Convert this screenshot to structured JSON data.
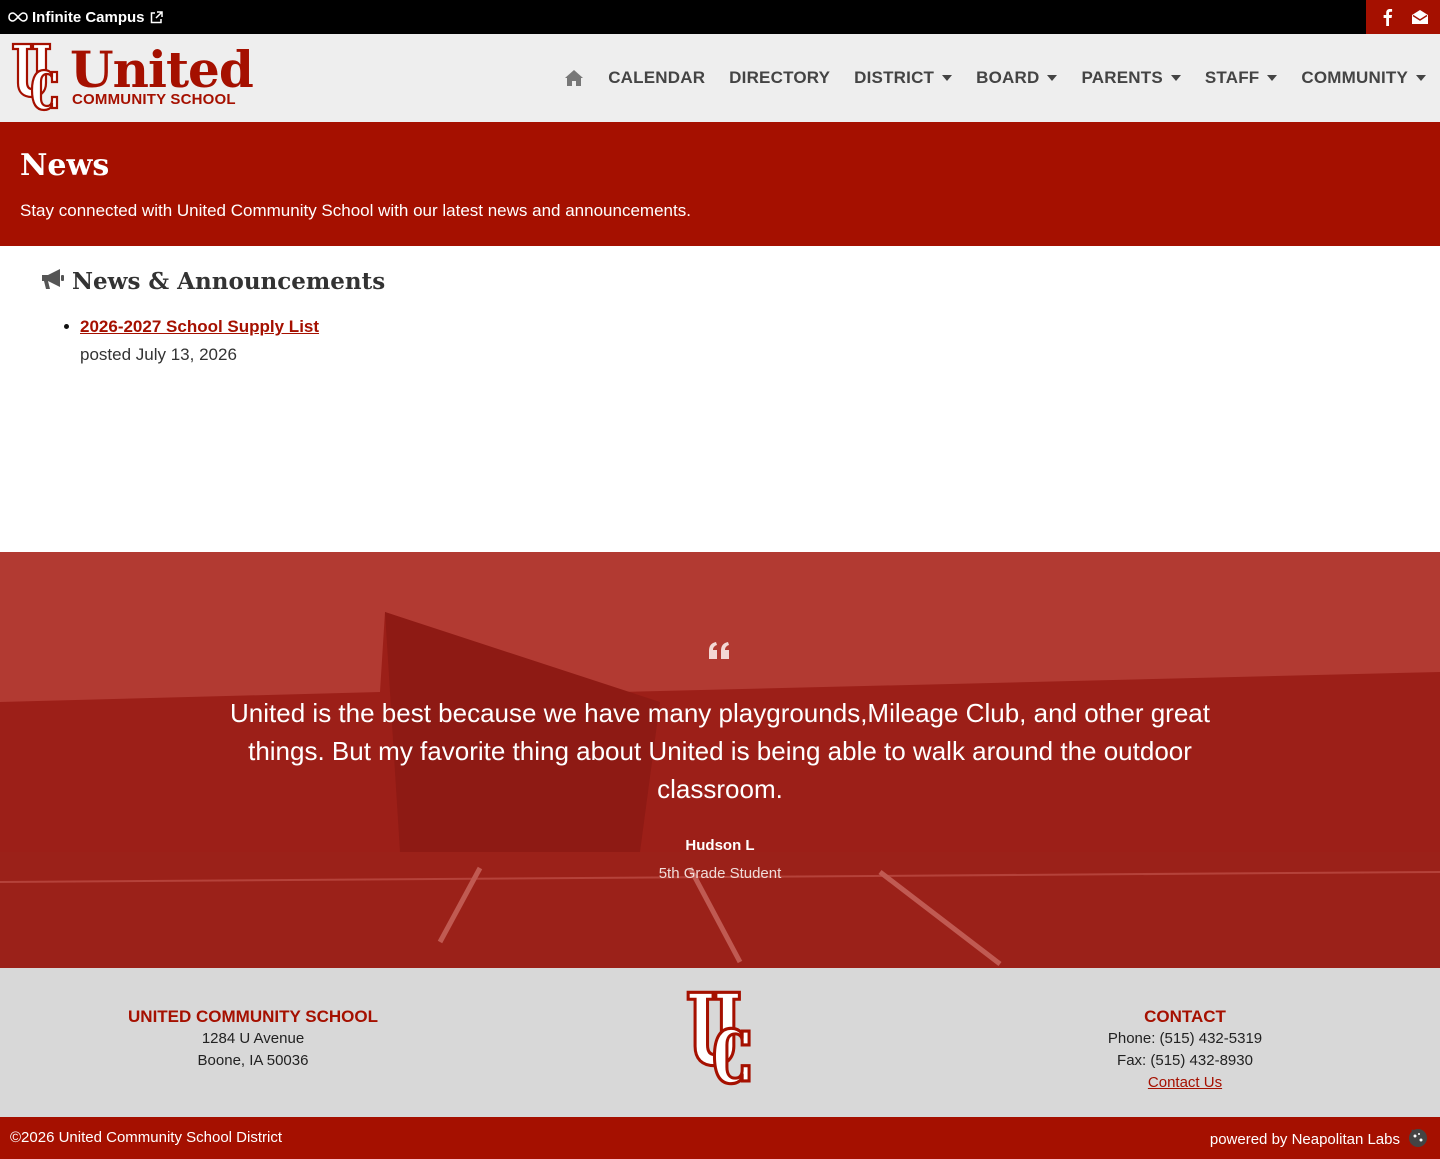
{
  "topbar": {
    "campus_link_label": "Infinite Campus",
    "social": [
      {
        "icon": "facebook-icon"
      },
      {
        "icon": "email-icon"
      }
    ]
  },
  "header": {
    "logo_title": "United",
    "logo_subtitle": "COMMUNITY SCHOOL",
    "nav": [
      {
        "label": "CALENDAR",
        "dropdown": false
      },
      {
        "label": "DIRECTORY",
        "dropdown": false
      },
      {
        "label": "DISTRICT",
        "dropdown": true
      },
      {
        "label": "BOARD",
        "dropdown": true
      },
      {
        "label": "PARENTS",
        "dropdown": true
      },
      {
        "label": "STAFF",
        "dropdown": true
      },
      {
        "label": "COMMUNITY",
        "dropdown": true
      }
    ]
  },
  "hero": {
    "title": "News",
    "subtitle": "Stay connected with United Community School with our latest news and announcements."
  },
  "news": {
    "heading": "News & Announcements",
    "items": [
      {
        "title": "2026-2027 School Supply List",
        "posted": "posted July 13, 2026"
      }
    ]
  },
  "testimonial": {
    "quote": "United is the best because we have many playgrounds,Mileage Club, and other great things. But my favorite thing about United is being able to walk around the outdoor classroom.",
    "author": "Hudson L",
    "role": "5th Grade Student"
  },
  "footer": {
    "school_name": "UNITED COMMUNITY SCHOOL",
    "address_line1": "1284 U Avenue",
    "address_line2": "Boone, IA 50036",
    "contact_title": "CONTACT",
    "phone": "Phone: (515) 432-5319",
    "fax": "Fax: (515) 432-8930",
    "contact_link": "Contact Us",
    "copyright": "©2026 United Community School District",
    "powered_by": "powered by Neapolitan Labs"
  },
  "colors": {
    "brand_red": "#a51000",
    "topbar_black": "#000000",
    "header_gray": "#eeeeee",
    "footer_gray": "#d8d8d8"
  }
}
